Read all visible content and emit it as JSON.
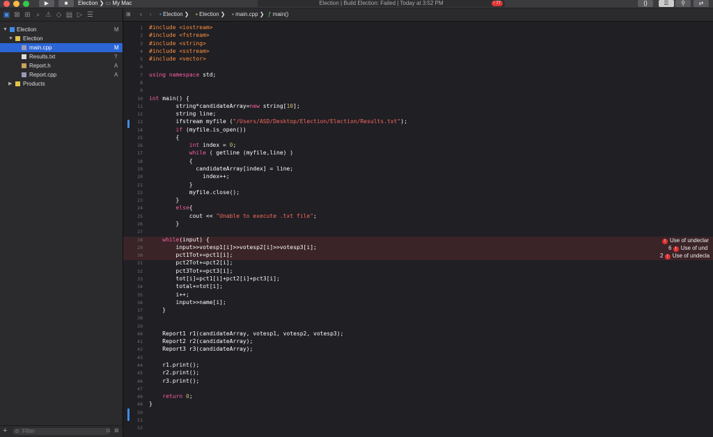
{
  "toolbar": {
    "scheme": "Election",
    "destination": "My Mac",
    "activity_text": "Election | Build Election: Failed | Today at 3:52 PM",
    "error_count": "77"
  },
  "navigator": {
    "filter_placeholder": "Filter",
    "items": [
      {
        "label": "Election",
        "badge": "M"
      },
      {
        "label": "Election",
        "badge": ""
      },
      {
        "label": "main.cpp",
        "badge": "M"
      },
      {
        "label": "Results.txt",
        "badge": "?"
      },
      {
        "label": "Report.h",
        "badge": "A"
      },
      {
        "label": "Report.cpp",
        "badge": "A"
      },
      {
        "label": "Products",
        "badge": ""
      }
    ]
  },
  "jumpbar": {
    "crumbs": [
      "Election",
      "Election",
      "main.cpp",
      "main()"
    ]
  },
  "editor": {
    "line_numbers": [
      "1",
      "2",
      "3",
      "4",
      "5",
      "6",
      "7",
      "8",
      "9",
      "10",
      "11",
      "12",
      "13",
      "14",
      "15",
      "16",
      "17",
      "18",
      "19",
      "20",
      "21",
      "22",
      "23",
      "24",
      "25",
      "26",
      "27",
      "28",
      "29",
      "30",
      "31",
      "32",
      "33",
      "34",
      "35",
      "36",
      "37",
      "38",
      "39",
      "40",
      "41",
      "42",
      "43",
      "44",
      "45",
      "46",
      "47",
      "48",
      "49",
      "50",
      "51",
      "52"
    ],
    "lines": [
      "#include <iostream>",
      "#include <fstream>",
      "#include <string>",
      "#include <sstream>",
      "#include <vector>",
      "",
      "using namespace std;",
      "",
      "",
      "int main() {",
      "        string*candidateArray=new string[10];",
      "        string line;",
      "        ifstream myfile (\"/Users/ASD/Desktop/Election/Election/Results.txt\");",
      "        if (myfile.is_open())",
      "        {",
      "            int index = 0;",
      "            while ( getline (myfile,line) )",
      "            {",
      "              candidateArray[index] = line;",
      "                index++;",
      "            }",
      "            myfile.close();",
      "        }",
      "        else{",
      "            cout << \"Unable to execute .txt file\";",
      "        }",
      "",
      "    while(input) {",
      "        input>>votesp1[i]>>votesp2[i]>>votesp3[i];",
      "        pct1Tot+=pct1[i];",
      "        pct2Tot+=pct2[i];",
      "        pct3Tot+=pct3[i];",
      "        tot[i]=pct1[i]+pct2[i]+pct3[i];",
      "        total+=tot[i];",
      "        i++;",
      "        input>>name[i];",
      "    }",
      "",
      "",
      "    Report1 r1(candidateArray, votesp1, votesp2, votesp3);",
      "    Report2 r2(candidateArray);",
      "    Report3 r3(candidateArray);",
      "",
      "    r1.print();",
      "    r2.print();",
      "    r3.print();",
      "",
      "    return 0;",
      "}",
      "",
      "",
      ""
    ]
  },
  "issues": [
    {
      "count": "",
      "text": "Use of undeclar"
    },
    {
      "count": "6",
      "text": "Use of und"
    },
    {
      "count": "2",
      "text": "Use of undecla"
    }
  ],
  "colors": {
    "accent": "#3f8ce6",
    "selection": "#2c66d6",
    "error": "#dd3333",
    "keyword": "#fc5fa3",
    "string": "#fc6a5d",
    "preprocessor": "#fd8f3f",
    "number": "#d0bf69"
  }
}
